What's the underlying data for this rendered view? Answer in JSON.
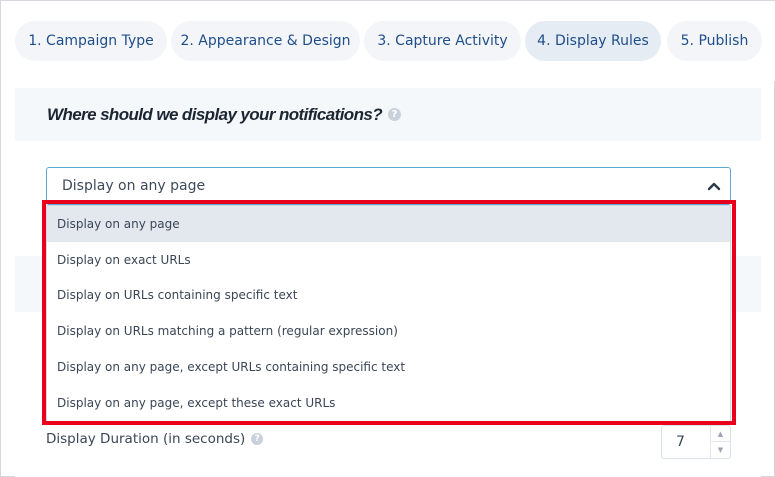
{
  "tabs": [
    {
      "label": "1. Campaign Type",
      "active": false
    },
    {
      "label": "2. Appearance & Design",
      "active": false
    },
    {
      "label": "3. Capture Activity",
      "active": false
    },
    {
      "label": "4. Display Rules",
      "active": true
    },
    {
      "label": "5. Publish",
      "active": false
    }
  ],
  "question": {
    "text": "Where should we display your notifications?",
    "help_icon": "question-circle-icon"
  },
  "display_select": {
    "value": "Display on any page",
    "expanded": true,
    "chevron_icon": "chevron-up-icon",
    "options": [
      {
        "label": "Display on any page",
        "selected": true
      },
      {
        "label": "Display on exact URLs",
        "selected": false
      },
      {
        "label": "Display on URLs containing specific text",
        "selected": false
      },
      {
        "label": "Display on URLs matching a pattern (regular expression)",
        "selected": false
      },
      {
        "label": "Display on any page, except URLs containing specific text",
        "selected": false
      },
      {
        "label": "Display on any page, except these exact URLs",
        "selected": false
      }
    ]
  },
  "duration": {
    "label": "Display Duration (in seconds)",
    "help_icon": "question-circle-icon",
    "value": "7"
  },
  "colors": {
    "accent": "#1f4e8a",
    "focus_border": "#5aa9d6",
    "annotation_box": "#e8001c"
  }
}
